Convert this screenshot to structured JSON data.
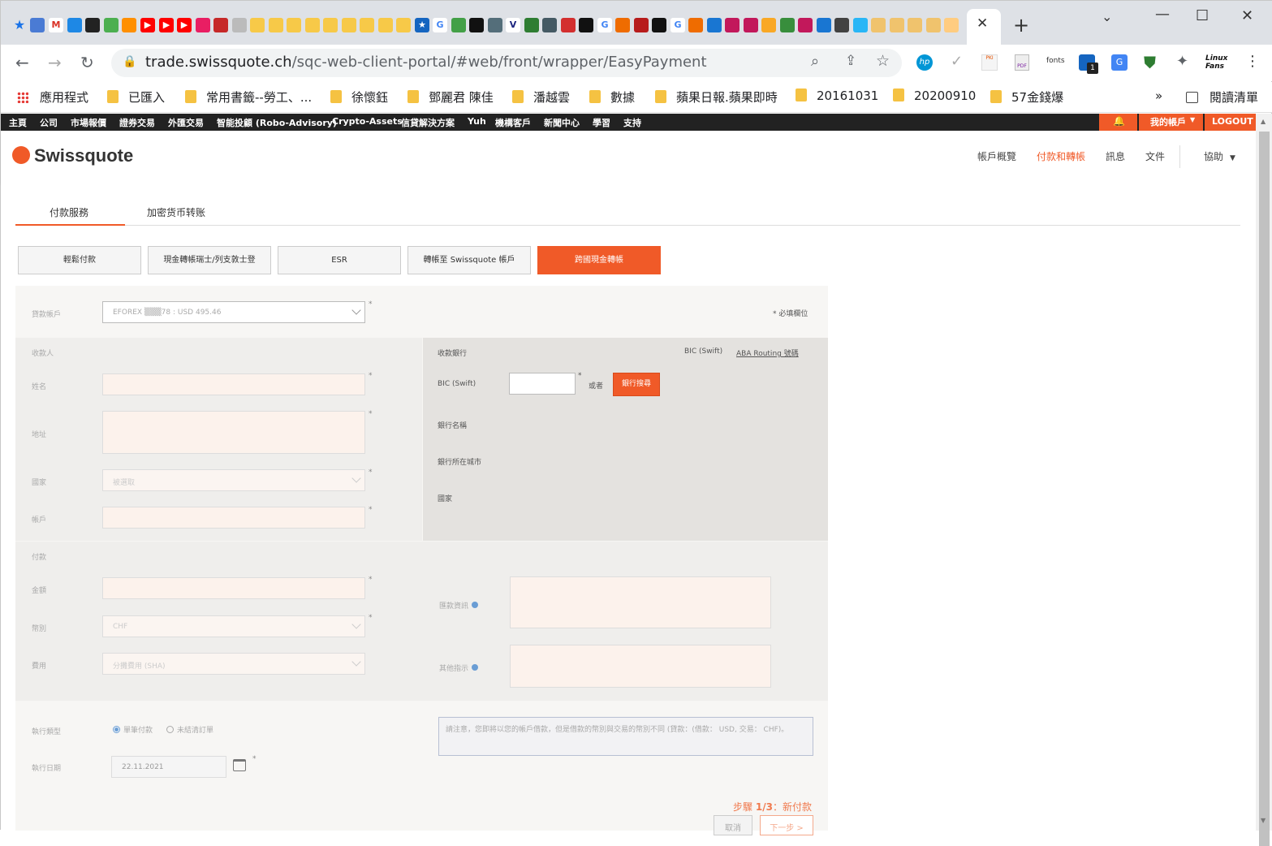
{
  "browser": {
    "url_domain": "trade.swissquote.ch",
    "url_path": "/sqc-web-client-portal/#web/front/wrapper/EasyPayment",
    "extension_labels": [
      "fonts",
      "Linux Fans"
    ],
    "extension_badge": "1"
  },
  "bookmarks": {
    "apps": "應用程式",
    "items": [
      "已匯入",
      "常用書籤--勞工、...",
      "徐懷鈺",
      "鄧麗君 陳佳",
      "潘越雲",
      "數據",
      "蘋果日報.蘋果即時",
      "20161031",
      "20200910",
      "57金錢爆"
    ],
    "more": "»",
    "reading_list": "閱讀清單"
  },
  "topnav": {
    "items": [
      "主頁",
      "公司",
      "市場報價",
      "證券交易",
      "外匯交易",
      "智能投顧 (Robo-Advisory)",
      "Crypto-Assets",
      "信貸解決方案",
      "Yuh",
      "機構客戶",
      "新聞中心",
      "學習",
      "支持"
    ],
    "my_account": "我的帳戶",
    "logout": "LOGOUT"
  },
  "header": {
    "logo": "Swissquote",
    "nav": [
      "帳戶概覽",
      "付款和轉帳",
      "訊息",
      "文件"
    ],
    "help": "協助"
  },
  "subtabs": [
    "付款服務",
    "加密货币转账"
  ],
  "payment_types": [
    "輕鬆付款",
    "現金轉帳瑞士/列支敦士登",
    "ESR",
    "轉帳至 Swissquote 帳戶",
    "跨國現金轉帳"
  ],
  "form": {
    "debit_label": "貸款帳戶",
    "debit_value": "EFOREX ▒▒▒78 : USD 495.46",
    "required_note": "* 必填欄位",
    "required_star": "*",
    "payee_title": "收款人",
    "name_label": "姓名",
    "address_label": "地址",
    "country_label": "國家",
    "country_placeholder": "被選取",
    "account_label": "帳戶",
    "bank_title": "收款銀行",
    "bic_link": "BIC (Swift)",
    "aba_link": "ABA Routing 號碼",
    "bic_label": "BIC (Swift)",
    "or_text": "或者",
    "bank_search": "銀行搜尋",
    "bank_name_label": "銀行名稱",
    "bank_city_label": "銀行所在城市",
    "bank_country_label": "國家",
    "payment_title": "付款",
    "amount_label": "金額",
    "currency_label": "幣別",
    "currency_value": "CHF",
    "fee_label": "費用",
    "fee_value": "分攤費用 (SHA)",
    "remittance_label": "匯款資訊",
    "other_label": "其他指示",
    "exec_type_label": "執行類型",
    "radio_single": "單筆付款",
    "radio_standing": "未結清訂單",
    "exec_date_label": "執行日期",
    "exec_date_value": "22.11.2021",
    "note": "請注意，您即將以您的帳戶借款，但是借款的幣別與交易的幣別不同 (貸款：(借款： USD, 交易： CHF)。",
    "step": "步驟",
    "step_num": "1/3",
    "step_name": "：新付款",
    "cancel": "取消",
    "next": "下一步 >"
  }
}
